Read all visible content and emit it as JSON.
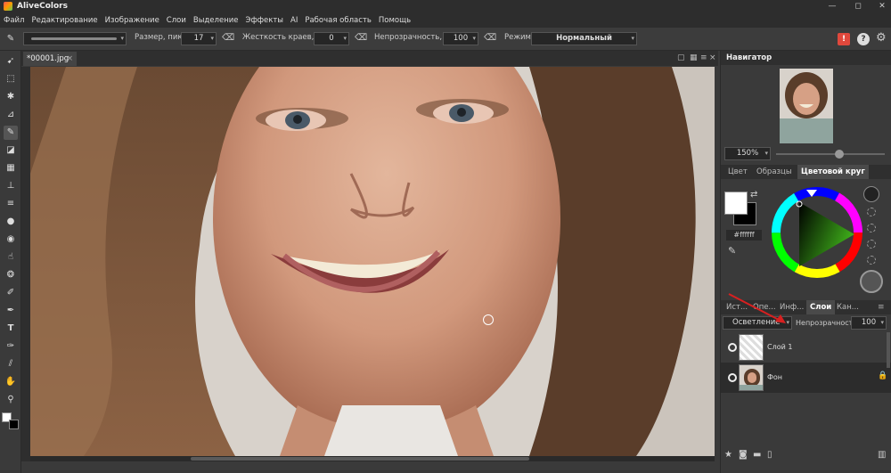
{
  "app": {
    "title": "AliveColors"
  },
  "window": {
    "minimize": "—",
    "maximize": "◻",
    "close": "✕"
  },
  "menu": [
    "Файл",
    "Редактирование",
    "Изображение",
    "Слои",
    "Выделение",
    "Эффекты",
    "AI",
    "Рабочая область",
    "Помощь"
  ],
  "options": {
    "size_label": "Размер, пикс",
    "size_value": "17",
    "hardness_label": "Жесткость краев, %",
    "hardness_value": "0",
    "opacity_label": "Непрозрачность, %",
    "opacity_value": "100",
    "mode_label": "Режим:",
    "mode_value": "Нормальный",
    "help": "?",
    "alert": "!"
  },
  "document": {
    "tab_label": "*00001.jpg",
    "tab_close": "×"
  },
  "navigator": {
    "title": "Навигатор",
    "zoom": "150%"
  },
  "color_panel": {
    "tabs": [
      "Цвет",
      "Образцы",
      "Цветовой круг"
    ],
    "active_tab": "Цветовой круг",
    "hex": "#ffffff",
    "foreground": "#ffffff",
    "background": "#000000"
  },
  "layers_panel": {
    "tabs": [
      "Ист...",
      "Опе...",
      "Инф...",
      "Слои",
      "Кан..."
    ],
    "active_tab": "Слои",
    "blend_mode": "Осветление",
    "opacity_label": "Непрозрачность",
    "opacity_value": "100",
    "layers": [
      {
        "name": "Слой 1"
      },
      {
        "name": "Фон"
      }
    ]
  },
  "colors": {
    "accent": "#e0483c",
    "panel": "#3a3a3a",
    "dark": "#2d2d2d"
  }
}
